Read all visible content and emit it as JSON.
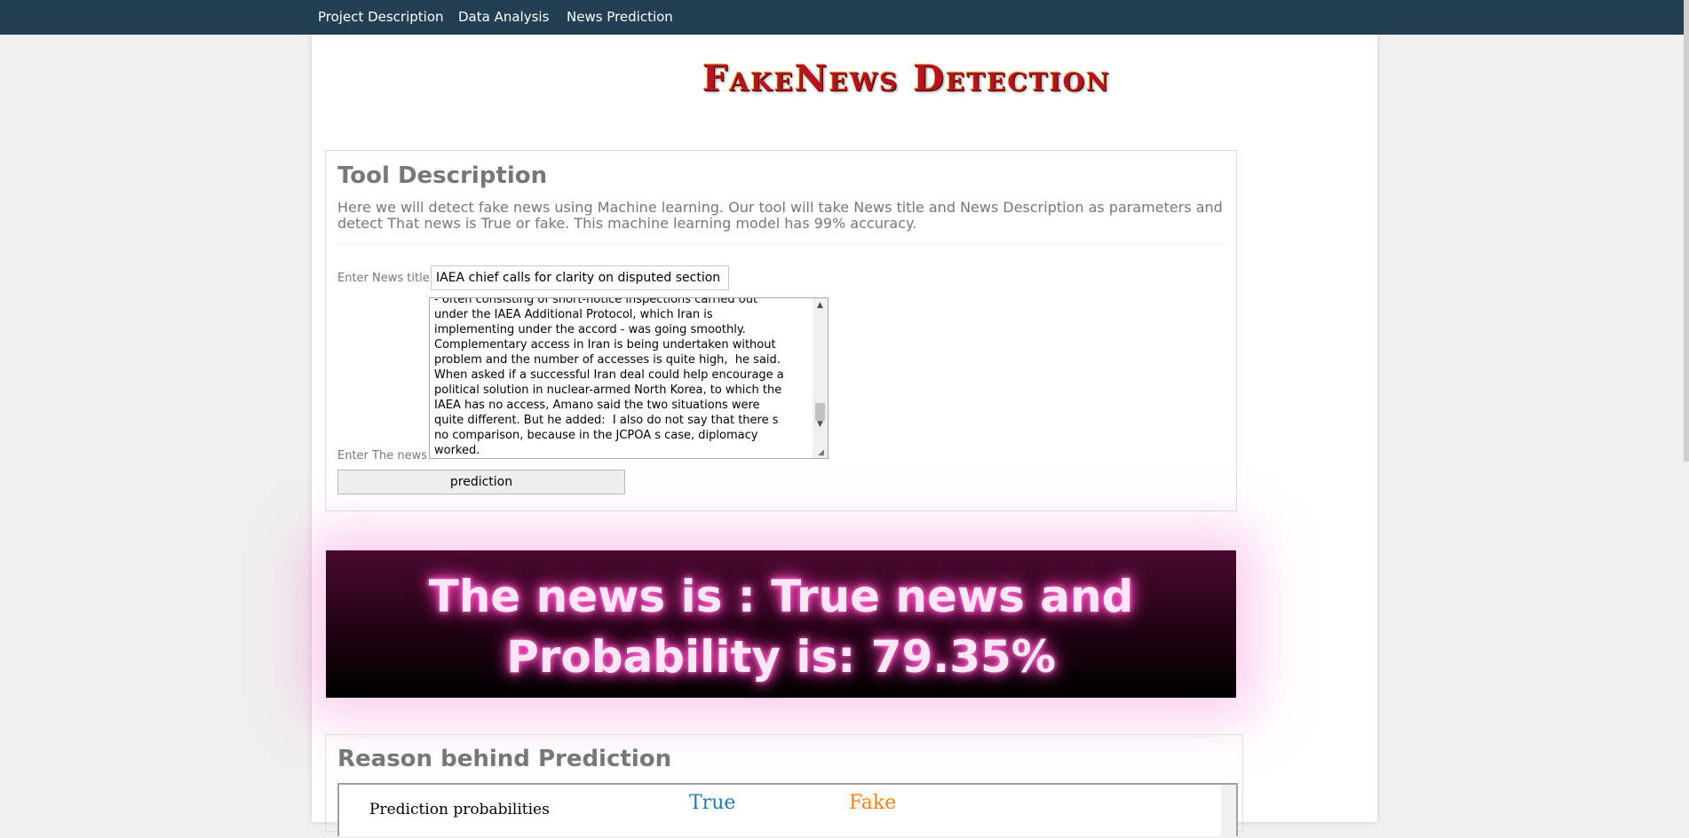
{
  "nav": {
    "items": [
      "Project Description",
      "Data Analysis",
      "News Prediction"
    ]
  },
  "logo": {
    "text": "FakeNews Detection"
  },
  "tool": {
    "title": "Tool Description",
    "description": "Here we will detect fake news using Machine learning. Our tool will take News title and News Description as parameters and detect That news is True or fake. This machine learning model has 99% accuracy.",
    "title_label": "Enter News title",
    "title_value": "IAEA chief calls for clarity on disputed section of",
    "news_label": "Enter The news",
    "news_value": "- often consisting of short-notice inspections carried out\nunder the IAEA Additional Protocol, which Iran is\nimplementing under the accord - was going smoothly.\nComplementary access in Iran is being undertaken without\nproblem and the number of accesses is quite high,  he said.\nWhen asked if a successful Iran deal could help encourage a\npolitical solution in nuclear-armed North Korea, to which the\nIAEA has no access, Amano said the two situations were\nquite different. But he added:  I also do not say that there s\nno comparison, because in the JCPOA s case, diplomacy\nworked.",
    "button_label": "prediction"
  },
  "result": {
    "text": "The news is : True news and Probability is: 79.35%"
  },
  "reason": {
    "title": "Reason behind Prediction",
    "pp_label": "Prediction probabilities",
    "true_label": "True",
    "fake_label": "Fake"
  },
  "colors": {
    "navbar": "#233f53",
    "true": "#1f77b4",
    "fake": "#ff7f0e",
    "glow": "#ff3fb8"
  }
}
